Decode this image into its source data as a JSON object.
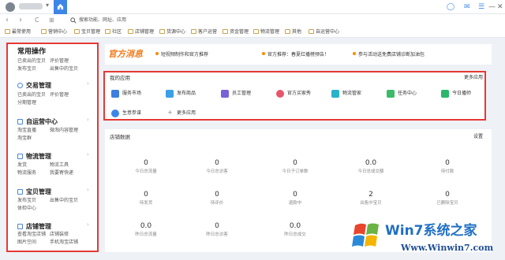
{
  "titlebar": {
    "caret": "▾",
    "window_controls": [
      "◯",
      "✉",
      "☰",
      "—",
      "☐",
      "✕"
    ]
  },
  "nav": {
    "back": "‹",
    "forward": "›",
    "refresh": "C",
    "grid": "⊞",
    "search_placeholder": "搜索功能、网址、应用"
  },
  "bookmarks": [
    "最常使用",
    "营销中心",
    "宝贝管理",
    "社区",
    "店铺管理",
    "货源中心",
    "客户运营",
    "资金管理",
    "物流管理",
    "其他",
    "自运营中心"
  ],
  "sidebar": {
    "sections": [
      {
        "title": "常用操作",
        "links": [
          "已卖出的宝贝",
          "评价管理",
          "发布宝贝",
          "出售中的宝贝"
        ]
      },
      {
        "title": "交易管理",
        "links": [
          "已卖出的宝贝",
          "评价管理",
          "分期管理"
        ]
      },
      {
        "title": "自运营中心",
        "links": [
          "淘宝直播",
          "微淘内容管理",
          "淘宝群"
        ]
      },
      {
        "title": "物流管理",
        "links": [
          "发货",
          "物流工具",
          "物流服务",
          "我要寄快递"
        ]
      },
      {
        "title": "宝贝管理",
        "links": [
          "发布宝贝",
          "出售中的宝贝",
          "体检中心"
        ]
      },
      {
        "title": "店铺管理",
        "links": [
          "查看淘宝店铺",
          "店铺装修",
          "图片空间",
          "手机淘宝店铺"
        ]
      }
    ]
  },
  "notice": {
    "label": "官方消息",
    "items": [
      "短视频制作和官方推荐",
      "官方推荐：春夏红播榜预告！",
      "参与活动送免费店铺诊断加油包"
    ]
  },
  "apps": {
    "title": "我的应用",
    "more": "更多应用",
    "items": [
      {
        "label": "服务市场",
        "color": "#3d7fe0"
      },
      {
        "label": "发布商品",
        "color": "#3aa0e8"
      },
      {
        "label": "员工管理",
        "color": "#7a63d8"
      },
      {
        "label": "官方买家秀",
        "color": "#e8556a"
      },
      {
        "label": "物流管家",
        "color": "#27b3c9"
      },
      {
        "label": "任务中心",
        "color": "#3cba6a"
      },
      {
        "label": "今日播师",
        "color": "#2ab86a"
      },
      {
        "label": "生意参谋",
        "color": "#3d86e8"
      },
      {
        "label": "更多应用",
        "color": "#ffffff"
      }
    ]
  },
  "stats": {
    "title": "店铺数据",
    "settings": "设置",
    "rows": [
      [
        {
          "v": "0",
          "l": "今日总流量"
        },
        {
          "v": "0",
          "l": "今日总访客"
        },
        {
          "v": "0",
          "l": "今日子订单数"
        },
        {
          "v": "0.0",
          "l": "今日总成交额"
        },
        {
          "v": "0",
          "l": "待付款"
        }
      ],
      [
        {
          "v": "0",
          "l": "待发货"
        },
        {
          "v": "0",
          "l": "待评价"
        },
        {
          "v": "0",
          "l": "退款中"
        },
        {
          "v": "2",
          "l": "出售中宝贝"
        },
        {
          "v": "0",
          "l": "已删除宝贝"
        }
      ],
      [
        {
          "v": "0.0",
          "l": "昨日总流量"
        },
        {
          "v": "0",
          "l": "昨日总访客"
        },
        {
          "v": "0.0",
          "l": "昨日总成交"
        }
      ]
    ]
  },
  "watermark": {
    "brand": "Win7系统之家",
    "url": "Www.Winwin7.com"
  }
}
